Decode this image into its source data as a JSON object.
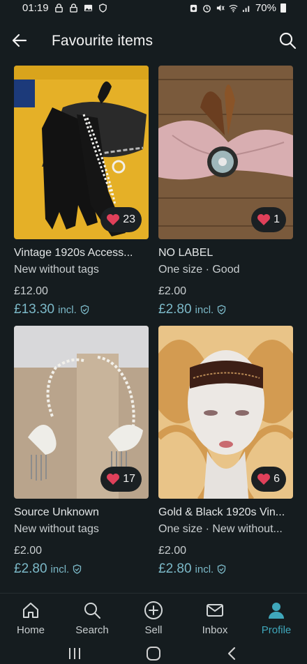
{
  "status_bar": {
    "time": "01:19",
    "battery": "70%"
  },
  "header": {
    "title": "Favourite items"
  },
  "items": [
    {
      "title": "Vintage 1920s Access...",
      "subtitle": "New without tags",
      "price": "£12.00",
      "price_incl": "£13.30",
      "incl_label": "incl.",
      "favourites": "23"
    },
    {
      "title": "NO LABEL",
      "subtitle": "One size · Good",
      "price": "£2.00",
      "price_incl": "£2.80",
      "incl_label": "incl.",
      "favourites": "1"
    },
    {
      "title": "Source Unknown",
      "subtitle": "New without tags",
      "price": "£2.00",
      "price_incl": "£2.80",
      "incl_label": "incl.",
      "favourites": "17"
    },
    {
      "title": "Gold & Black 1920s Vin...",
      "subtitle": "One size · New without...",
      "price": "£2.00",
      "price_incl": "£2.80",
      "incl_label": "incl.",
      "favourites": "6"
    }
  ],
  "bottom_nav": [
    {
      "label": "Home",
      "icon": "home-icon"
    },
    {
      "label": "Search",
      "icon": "search-icon"
    },
    {
      "label": "Sell",
      "icon": "plus-circle-icon"
    },
    {
      "label": "Inbox",
      "icon": "mail-icon"
    },
    {
      "label": "Profile",
      "icon": "person-icon",
      "active": true
    }
  ],
  "colors": {
    "background": "#151c1f",
    "accent": "#3fa7bb",
    "price_accent": "#7cb9c8",
    "heart": "#e0405a"
  }
}
